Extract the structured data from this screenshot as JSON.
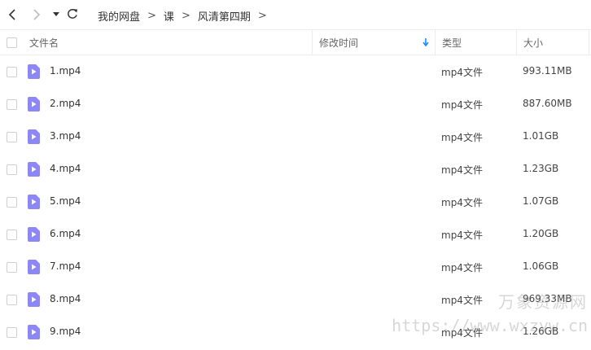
{
  "breadcrumb": [
    "我的网盘",
    "课",
    "风清第四期"
  ],
  "breadcrumb_separator": ">",
  "columns": {
    "name": "文件名",
    "modified": "修改时间",
    "type": "类型",
    "size": "大小"
  },
  "files": [
    {
      "name": "1.mp4",
      "type": "mp4文件",
      "size": "993.11MB"
    },
    {
      "name": "2.mp4",
      "type": "mp4文件",
      "size": "887.60MB"
    },
    {
      "name": "3.mp4",
      "type": "mp4文件",
      "size": "1.01GB"
    },
    {
      "name": "4.mp4",
      "type": "mp4文件",
      "size": "1.23GB"
    },
    {
      "name": "5.mp4",
      "type": "mp4文件",
      "size": "1.07GB"
    },
    {
      "name": "6.mp4",
      "type": "mp4文件",
      "size": "1.20GB"
    },
    {
      "name": "7.mp4",
      "type": "mp4文件",
      "size": "1.06GB"
    },
    {
      "name": "8.mp4",
      "type": "mp4文件",
      "size": "969.33MB"
    },
    {
      "name": "9.mp4",
      "type": "mp4文件",
      "size": "1.26GB"
    }
  ],
  "watermark": {
    "line1": "万象资源网",
    "line2": "https://www.wxzyw.cn"
  },
  "icons": {
    "back": "chevron-left-icon",
    "forward": "chevron-right-icon",
    "history": "caret-down-icon",
    "refresh": "refresh-icon",
    "sort": "arrow-down-icon",
    "file": "video-file-icon"
  },
  "colors": {
    "accent": "#1a8cff",
    "file_icon": "#8c87f2"
  }
}
